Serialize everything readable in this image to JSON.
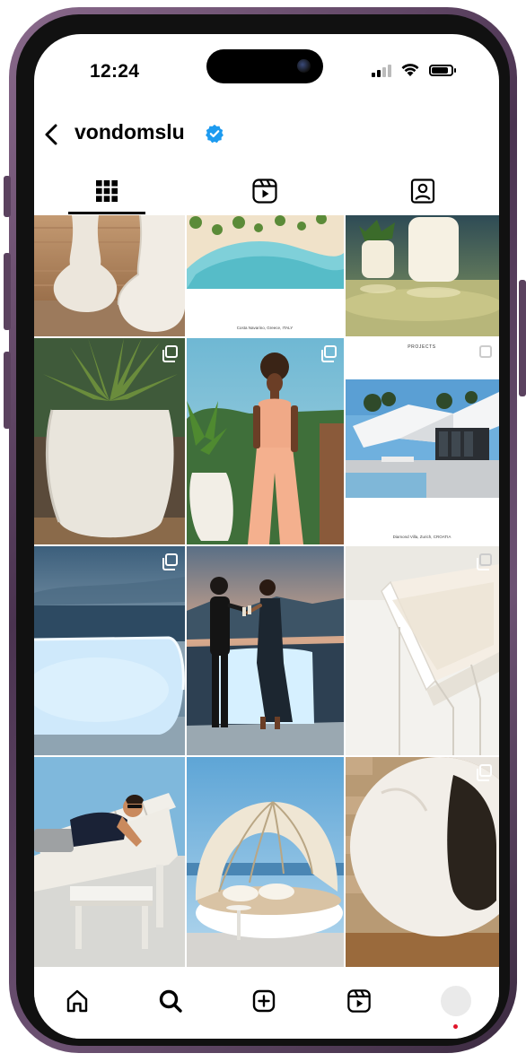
{
  "status_bar": {
    "time": "12:24"
  },
  "profile": {
    "username": "vondomslu",
    "verified": true
  },
  "icons": {
    "back": "chevron-left-icon",
    "verified": "verified-badge-icon",
    "tabs": [
      "grid-icon",
      "reels-icon",
      "tagged-icon"
    ],
    "nav": [
      "home-icon",
      "search-icon",
      "create-icon",
      "reels-icon",
      "profile-avatar"
    ]
  },
  "tabs": [
    {
      "name": "posts",
      "active": true
    },
    {
      "name": "reels",
      "active": false
    },
    {
      "name": "tagged",
      "active": false
    }
  ],
  "posts": {
    "caption_1": "Costa Navarino, Greece, ITALY",
    "project_heading": "PROJECTS",
    "caption_2": "Diamond Villa, Zurich, CROATIA"
  },
  "colors": {
    "verified_blue": "#1d9bf0",
    "notification_dot": "#e0142a",
    "frame": "#5b425f"
  }
}
